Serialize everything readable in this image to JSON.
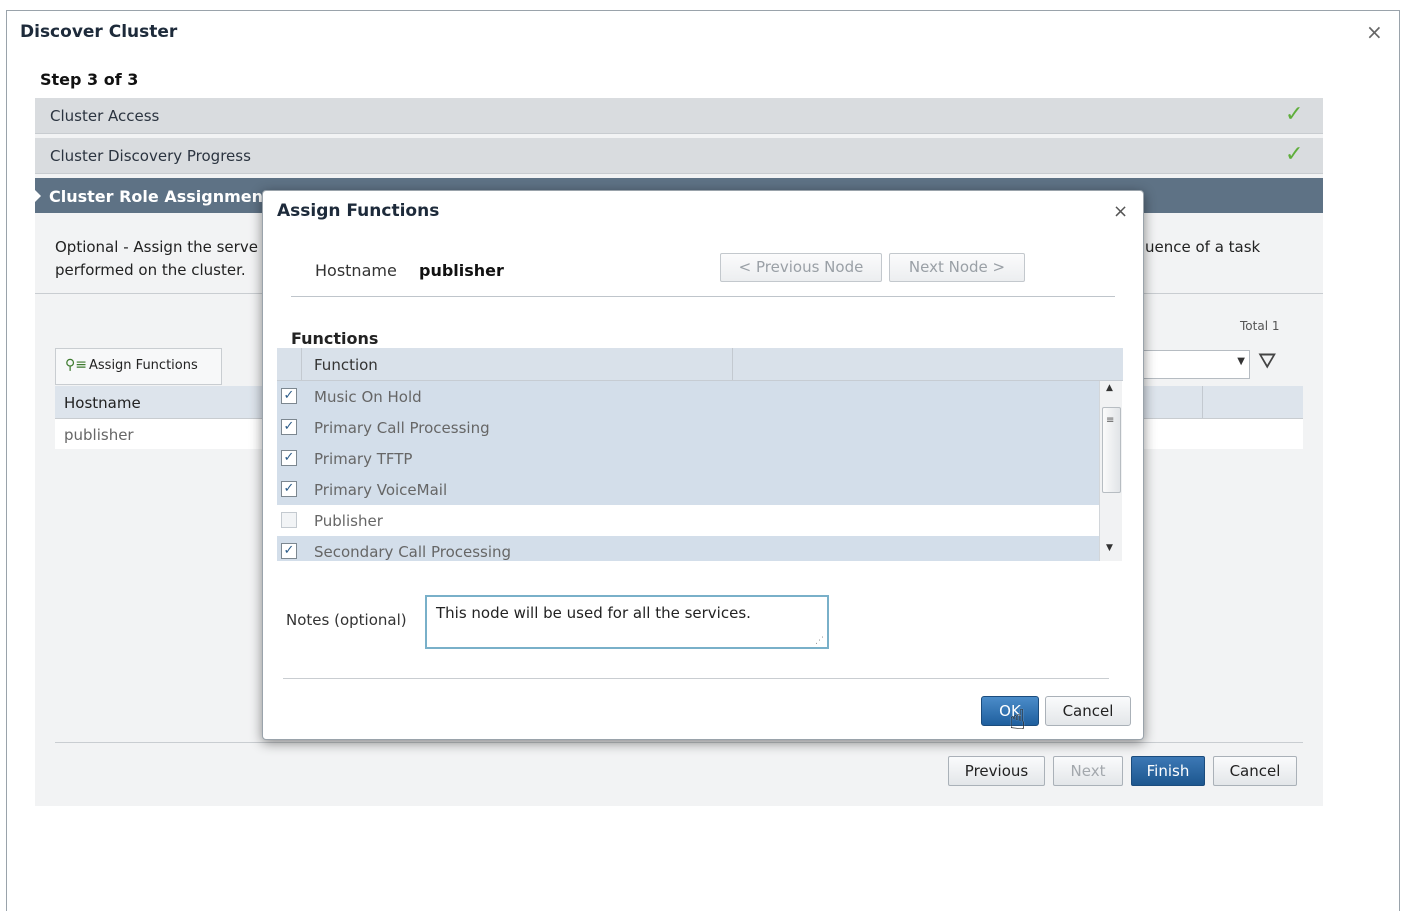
{
  "dialog": {
    "title": "Discover Cluster",
    "close": "×"
  },
  "wizard": {
    "step": "Step 3 of 3",
    "sections": [
      {
        "label": "Cluster Access",
        "status": "✓"
      },
      {
        "label": "Cluster Discovery Progress",
        "status": "✓"
      }
    ],
    "active_section": "Cluster Role Assignment",
    "optional_line1": "Optional - Assign the serve",
    "optional_line2": "performed on the cluster.",
    "optional_right": "uence of a task",
    "total": "Total 1",
    "toolbar": {
      "assign_label": "Assign Functions",
      "assign_icon": "assign-functions-icon",
      "filter_icon": "filter-icon"
    },
    "table": {
      "header": "Hostname",
      "rows": [
        "publisher"
      ]
    },
    "buttons": {
      "previous": "Previous",
      "next": "Next",
      "finish": "Finish",
      "cancel": "Cancel"
    }
  },
  "modal": {
    "title": "Assign Functions",
    "close": "×",
    "hostname_label": "Hostname",
    "hostname_value": "publisher",
    "prev_node": "< Previous Node",
    "next_node": "Next Node >",
    "functions_label": "Functions",
    "grid_header": "Function",
    "functions": [
      {
        "name": "Music On Hold",
        "checked": true
      },
      {
        "name": "Primary Call Processing",
        "checked": true
      },
      {
        "name": "Primary TFTP",
        "checked": true
      },
      {
        "name": "Primary VoiceMail",
        "checked": true
      },
      {
        "name": "Publisher",
        "checked": false
      },
      {
        "name": "Secondary Call Processing",
        "checked": true
      }
    ],
    "notes_label": "Notes (optional)",
    "notes_value": "This node will be used for all the services.",
    "ok": "OK",
    "cancel": "Cancel"
  },
  "colors": {
    "accent": "#5e7285",
    "primary_button": "#1f5f9e",
    "check_green": "#5fae3c",
    "selected_row": "#d3deea"
  }
}
